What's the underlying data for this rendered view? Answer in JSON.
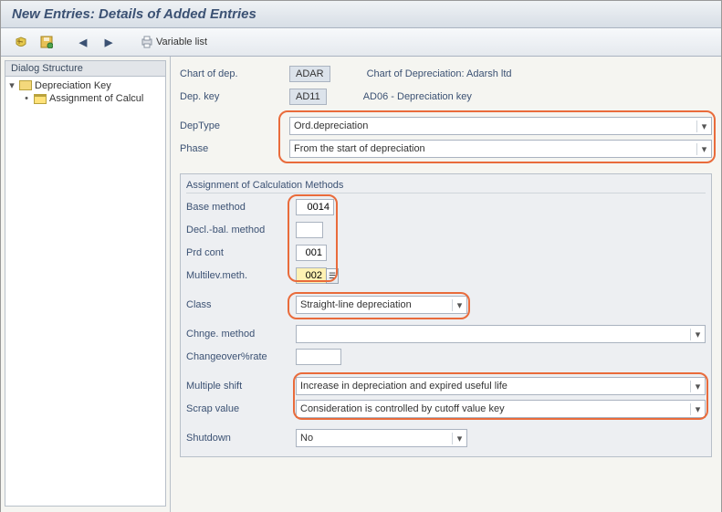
{
  "title": "New Entries: Details of Added Entries",
  "toolbar": {
    "variable_list": "Variable list"
  },
  "tree": {
    "header": "Dialog Structure",
    "root": "Depreciation Key",
    "child": "Assignment of Calcul"
  },
  "header_fields": {
    "chart_label": "Chart of dep.",
    "chart_value": "ADAR",
    "chart_desc": "Chart of Depreciation: Adarsh ltd",
    "depkey_label": "Dep. key",
    "depkey_value": "AD11",
    "depkey_desc": "AD06 - Depreciation key"
  },
  "top_selects": {
    "deptype_label": "DepType",
    "deptype_value": "Ord.depreciation",
    "phase_label": "Phase",
    "phase_value": "From the start of depreciation"
  },
  "calc_group": {
    "title": "Assignment of Calculation Methods",
    "base_label": "Base method",
    "base_value": "0014",
    "decl_label": "Decl.-bal. method",
    "decl_value": "",
    "prd_label": "Prd cont",
    "prd_value": "001",
    "multilev_label": "Multilev.meth.",
    "multilev_value": "002",
    "class_label": "Class",
    "class_value": "Straight-line depreciation",
    "chnge_label": "Chnge. method",
    "chnge_value": "",
    "changeover_label": "Changeover%rate",
    "changeover_value": "",
    "multshift_label": "Multiple shift",
    "multshift_value": "Increase in depreciation and expired useful life",
    "scrap_label": "Scrap value",
    "scrap_value": "Consideration is controlled by cutoff value key",
    "shutdown_label": "Shutdown",
    "shutdown_value": "No"
  }
}
